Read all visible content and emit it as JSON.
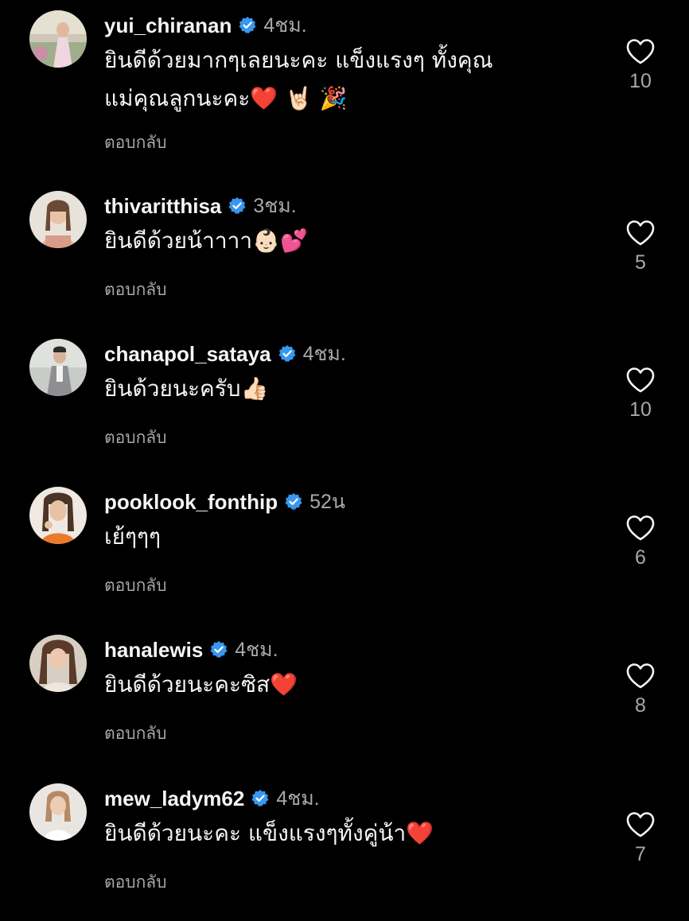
{
  "colors": {
    "background": "#000000",
    "text_primary": "#f5f5f5",
    "text_secondary": "#a8a8a8",
    "verified_blue": "#3897f0"
  },
  "comments": [
    {
      "username": "yui_chiranan",
      "verified": true,
      "time": "4ชม.",
      "text": "ยินดีด้วยมากๆเลยนะคะ แข็งแรงๆ ทั้งคุณแม่คุณลูกนะคะ❤️ 🤘🏻 🎉",
      "reply_label": "ตอบกลับ",
      "likes": "10",
      "like_icon": "heart-outline-icon"
    },
    {
      "username": "thivaritthisa",
      "verified": true,
      "time": "3ชม.",
      "text": "ยินดีด้วยน้าาาา👶🏻💕",
      "reply_label": "ตอบกลับ",
      "likes": "5",
      "like_icon": "heart-outline-icon"
    },
    {
      "username": "chanapol_sataya",
      "verified": true,
      "time": "4ชม.",
      "text": "ยินด้วยนะครับ👍🏻",
      "reply_label": "ตอบกลับ",
      "likes": "10",
      "like_icon": "heart-outline-icon"
    },
    {
      "username": "pooklook_fonthip",
      "verified": true,
      "time": "52น",
      "text": "เย้ๆๆๆ",
      "reply_label": "ตอบกลับ",
      "likes": "6",
      "like_icon": "heart-outline-icon"
    },
    {
      "username": "hanalewis",
      "verified": true,
      "time": "4ชม.",
      "text": "ยินดีด้วยนะคะซิส❤️",
      "reply_label": "ตอบกลับ",
      "likes": "8",
      "like_icon": "heart-outline-icon"
    },
    {
      "username": "mew_ladym62",
      "verified": true,
      "time": "4ชม.",
      "text": "ยินดีด้วยนะคะ แข็งแรงๆทั้งคู่น้า❤️",
      "reply_label": "ตอบกลับ",
      "likes": "7",
      "like_icon": "heart-outline-icon"
    }
  ]
}
